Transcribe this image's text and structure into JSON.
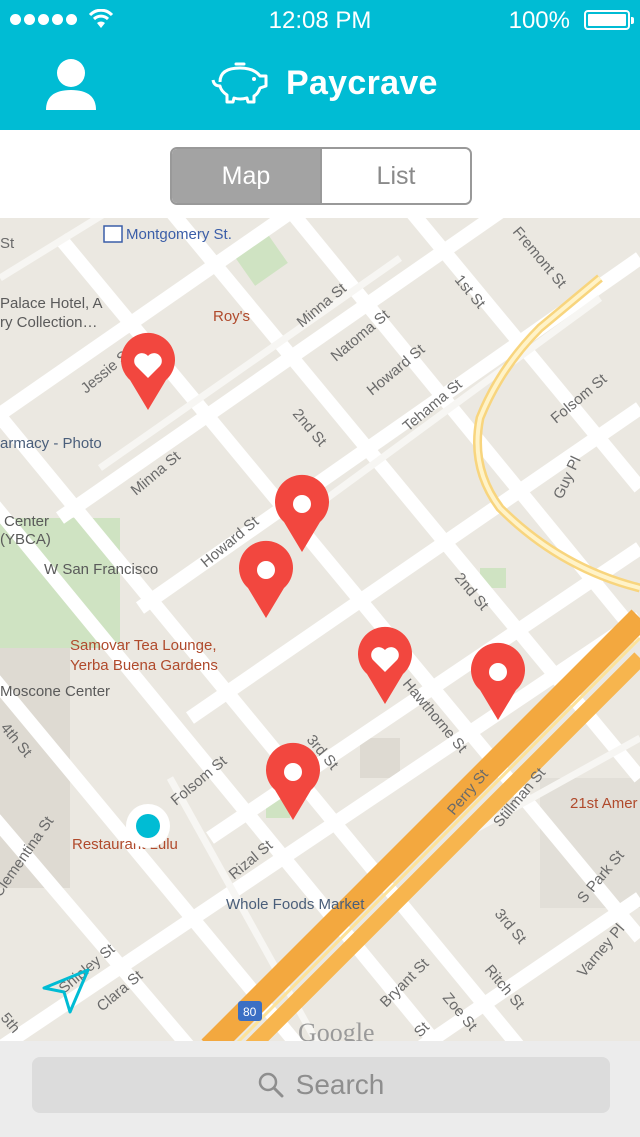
{
  "status": {
    "time": "12:08 PM",
    "battery": "100%"
  },
  "header": {
    "title": "Paycrave",
    "profile_icon": "user-icon",
    "logo_icon": "piggy-bank-icon"
  },
  "segment": {
    "options": [
      "Map",
      "List"
    ],
    "selected": "Map"
  },
  "map": {
    "place_labels": [
      "Montgomery St.",
      "Palace Hotel, A",
      "ry Collection…",
      "Roy's",
      "armacy - Photo",
      "Center",
      "(YBCA)",
      "W San Francisco",
      "Samovar Tea Lounge,",
      "Yerba Buena Gardens",
      "Moscone Center",
      "Restaurant Lulu",
      "Whole Foods Market",
      "21st Amer",
      "Google",
      "80"
    ],
    "street_labels": [
      "Minna St",
      "Natoma St",
      "Howard St",
      "Tehama St",
      "1st St",
      "Folsom St",
      "2nd St",
      "Jessie St",
      "Minna St",
      "Howard St",
      "2nd St",
      "Guy Pl",
      "Perry St",
      "Stillman St",
      "3rd St",
      "Folsom St",
      "Rizal St",
      "4th St",
      "Shipley St",
      "Clara St",
      "Bryant St",
      "Zoe St",
      "Ritch St",
      "3rd St",
      "S Park St",
      "Varney Pl",
      "Fremont St",
      "Clementina St",
      "Hawthorne St",
      "St",
      "St",
      "5th"
    ],
    "pins": [
      {
        "kind": "favorite"
      },
      {
        "kind": "location"
      },
      {
        "kind": "location"
      },
      {
        "kind": "favorite"
      },
      {
        "kind": "location"
      },
      {
        "kind": "location"
      }
    ],
    "colors": {
      "pin": "#f2473f",
      "user_dot": "#00bcd4",
      "accent": "#00bcd4"
    }
  },
  "search": {
    "placeholder": "Search"
  }
}
